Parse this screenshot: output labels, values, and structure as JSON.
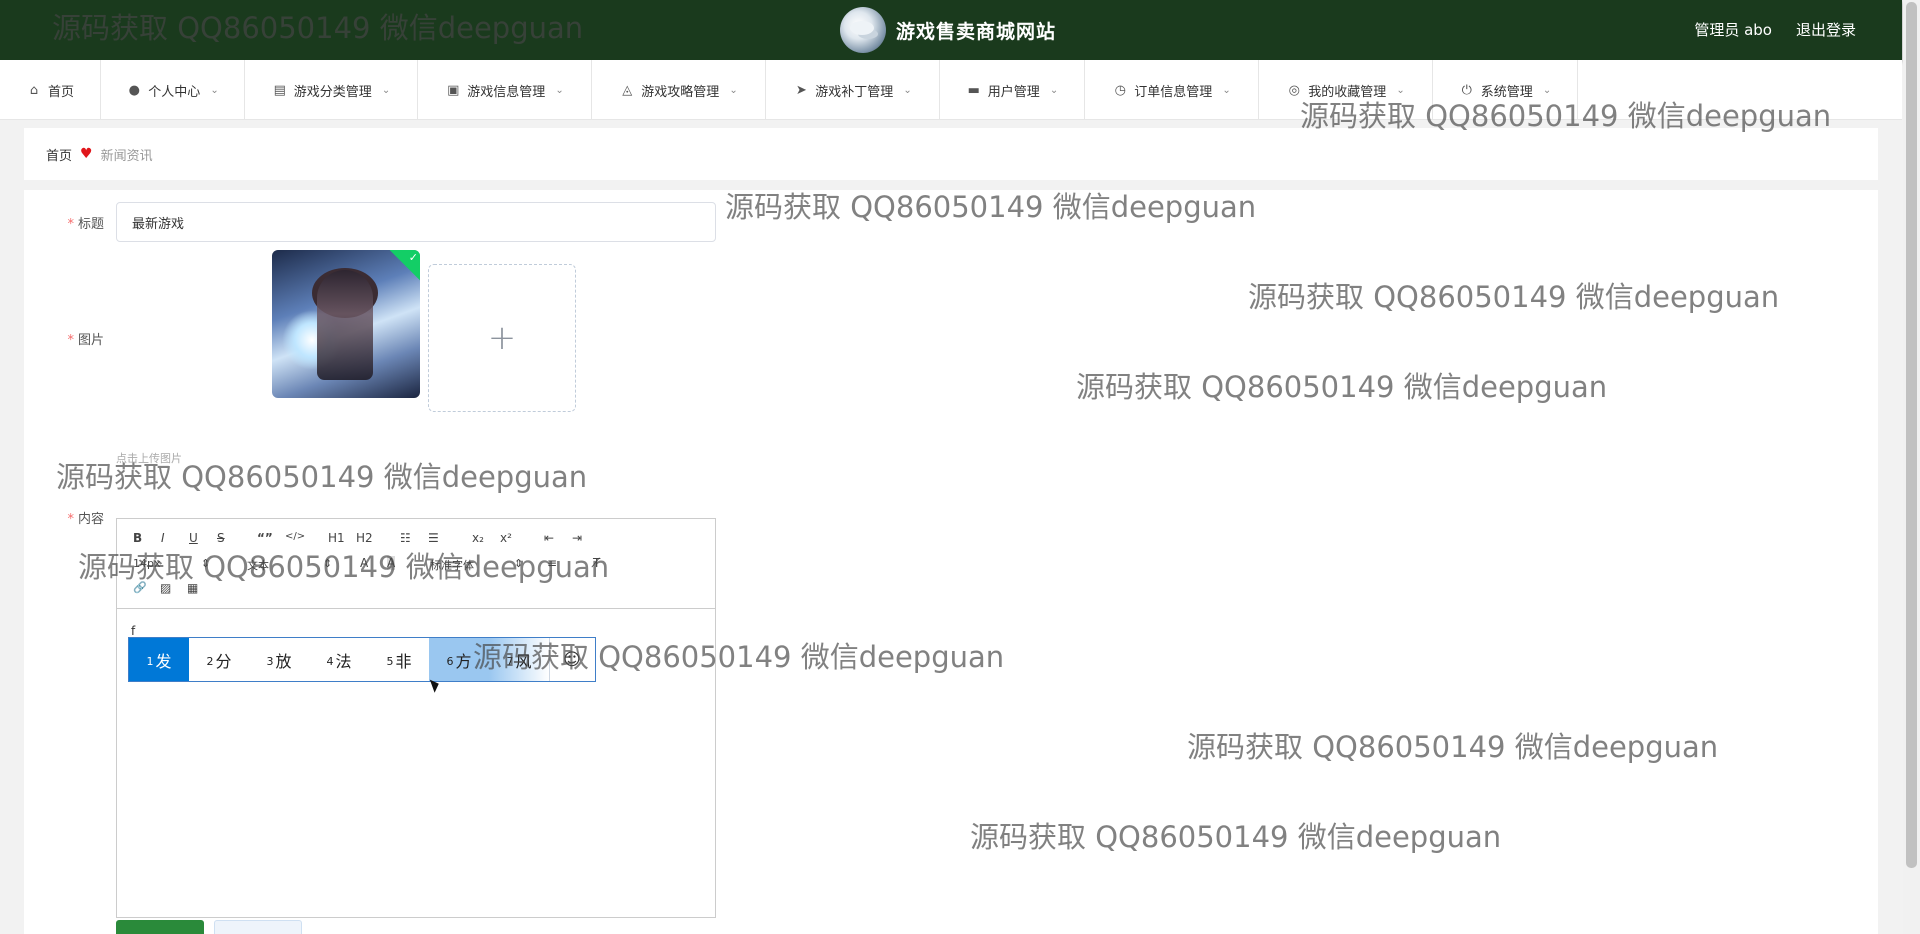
{
  "header": {
    "site_title": "游戏售卖商城网站",
    "admin_label": "管理员 abo",
    "logout": "退出登录"
  },
  "nav": {
    "items": [
      {
        "label": "首页",
        "icon": "home-icon",
        "glyph": "⌂"
      },
      {
        "label": "个人中心",
        "icon": "user-icon",
        "glyph": "●"
      },
      {
        "label": "游戏分类管理",
        "icon": "chat-icon",
        "glyph": "▤"
      },
      {
        "label": "游戏信息管理",
        "icon": "chart-icon",
        "glyph": "▣"
      },
      {
        "label": "游戏攻略管理",
        "icon": "bell-off-icon",
        "glyph": "◬"
      },
      {
        "label": "游戏补丁管理",
        "icon": "send-icon",
        "glyph": "➤"
      },
      {
        "label": "用户管理",
        "icon": "folder-icon",
        "glyph": "▬"
      },
      {
        "label": "订单信息管理",
        "icon": "clock-icon",
        "glyph": "◷"
      },
      {
        "label": "我的收藏管理",
        "icon": "globe-icon",
        "glyph": "◎"
      },
      {
        "label": "系统管理",
        "icon": "power-icon",
        "glyph": "⏻"
      }
    ]
  },
  "breadcrumb": {
    "home": "首页",
    "current": "新闻资讯"
  },
  "form": {
    "title_label": "标题",
    "title_value": "最新游戏",
    "image_label": "图片",
    "upload_tip": "点击上传图片",
    "upload_plus": "+",
    "content_label": "内容",
    "content_text": "f"
  },
  "toolbar": {
    "bold": "B",
    "italic": "I",
    "underline": "U",
    "strike": "S",
    "quote": "“”",
    "code": "</>",
    "h1": "H1",
    "h2": "H2",
    "ol": "☷",
    "ul": "☰",
    "sub": "x₂",
    "sup": "x²",
    "outdent": "⇤",
    "indent": "⇥",
    "size": "14px",
    "font": "文本",
    "align": "≡",
    "color": "A",
    "bg": "A",
    "clean": "T̸",
    "link": "🔗",
    "image": "▨",
    "video": "▦",
    "family": "标准字体"
  },
  "ime": {
    "candidates": [
      {
        "n": "1",
        "c": "发"
      },
      {
        "n": "2",
        "c": "分"
      },
      {
        "n": "3",
        "c": "放"
      },
      {
        "n": "4",
        "c": "法"
      },
      {
        "n": "5",
        "c": "非"
      },
      {
        "n": "6",
        "c": "方"
      },
      {
        "n": "7",
        "c": "风"
      }
    ],
    "emoji": "☺"
  },
  "watermark": "源码获取 QQ86050149 微信deepguan"
}
